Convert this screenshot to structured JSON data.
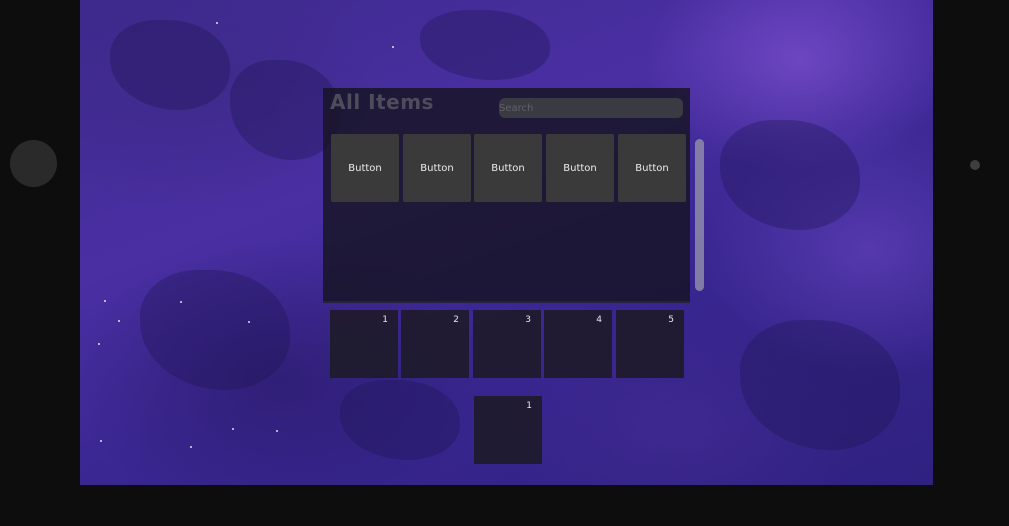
{
  "inventory": {
    "title": "All Items",
    "search_placeholder": "Search",
    "items": [
      {
        "label": "Button"
      },
      {
        "label": "Button"
      },
      {
        "label": "Button"
      },
      {
        "label": "Button"
      },
      {
        "label": "Button"
      }
    ]
  },
  "hotbar": {
    "slots": [
      "1",
      "2",
      "3",
      "4",
      "5"
    ]
  },
  "equipped": {
    "slot": "1"
  },
  "colors": {
    "background_accent": "#4a2fa3",
    "panel": "#16142a",
    "item_button": "#3a3a3a",
    "scrollbar": "#8a86a8"
  }
}
